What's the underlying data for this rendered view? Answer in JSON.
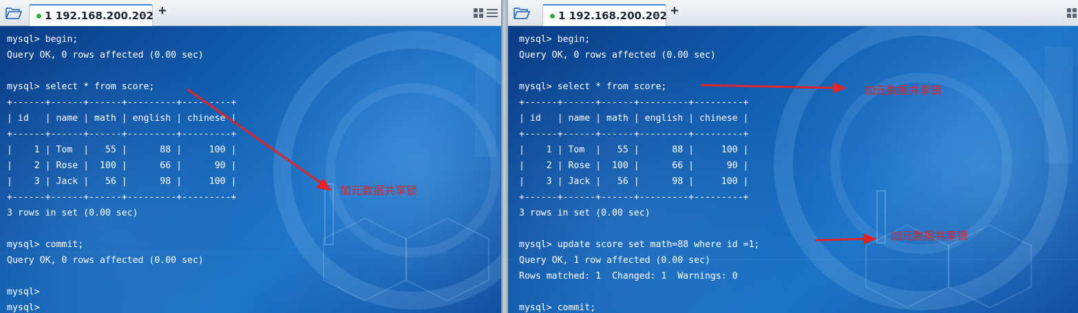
{
  "left_pane": {
    "tab": {
      "label": "1 192.168.200.202",
      "close": "×",
      "add": "+"
    },
    "lines": [
      "mysql> begin;",
      "Query OK, 0 rows affected (0.00 sec)",
      "",
      "mysql> select * from score;",
      "+------+------+------+---------+---------+",
      "| id   | name | math | english | chinese |",
      "+------+------+------+---------+---------+",
      "|    1 | Tom  |   55 |      88 |     100 |",
      "|    2 | Rose |  100 |      66 |      90 |",
      "|    3 | Jack |   56 |      98 |     100 |",
      "+------+------+------+---------+---------+",
      "3 rows in set (0.00 sec)",
      "",
      "mysql> commit;",
      "Query OK, 0 rows affected (0.00 sec)",
      "",
      "mysql>",
      "mysql>"
    ],
    "annotation": "加元数据共享锁"
  },
  "right_pane": {
    "tab": {
      "label": "1 192.168.200.202",
      "close": "×",
      "add": "+"
    },
    "lines": [
      "mysql> begin;",
      "Query OK, 0 rows affected (0.00 sec)",
      "",
      "mysql> select * from score;",
      "+------+------+------+---------+---------+",
      "| id   | name | math | english | chinese |",
      "+------+------+------+---------+---------+",
      "|    1 | Tom  |   55 |      88 |     100 |",
      "|    2 | Rose |  100 |      66 |      90 |",
      "|    3 | Jack |   56 |      98 |     100 |",
      "+------+------+------+---------+---------+",
      "3 rows in set (0.00 sec)",
      "",
      "mysql> update score set math=88 where id =1;",
      "Query OK, 1 row affected (0.00 sec)",
      "Rows matched: 1  Changed: 1  Warnings: 0",
      "",
      "mysql> commit;"
    ],
    "annotation_1": "加元数据共享锁",
    "annotation_2": "加元数据共享锁"
  },
  "colors": {
    "accent": "#3b84d6",
    "connected": "#2fae3c",
    "annotation": "#e0242a",
    "terminal_text": "#ffffff"
  },
  "icons": [
    "folder-open-icon",
    "layout-grid-icon",
    "menu-icon",
    "close-icon",
    "plus-icon"
  ]
}
